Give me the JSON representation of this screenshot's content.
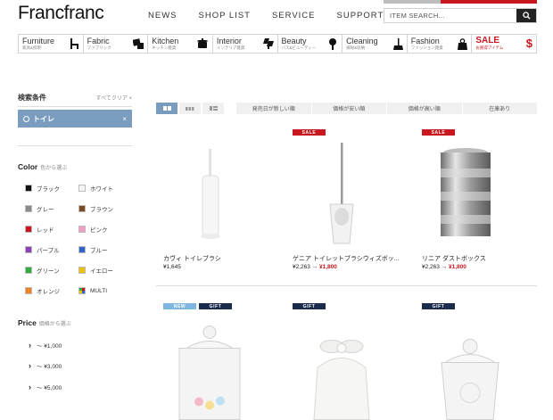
{
  "header": {
    "logo": "Francfranc",
    "nav": [
      "NEWS",
      "SHOP LIST",
      "SERVICE",
      "SUPPORT"
    ],
    "search_placeholder": "ITEM SEARCH..."
  },
  "categories": [
    {
      "name": "Furniture",
      "sub": "家具&照明",
      "icon": "chair-icon"
    },
    {
      "name": "Fabric",
      "sub": "ファブリック",
      "icon": "fabric-icon"
    },
    {
      "name": "Kitchen",
      "sub": "キッチン雑貨",
      "icon": "pot-icon"
    },
    {
      "name": "Interior",
      "sub": "インテリア雑貨",
      "icon": "lamp-icon"
    },
    {
      "name": "Beauty",
      "sub": "バス&ビューティー",
      "icon": "brush-icon"
    },
    {
      "name": "Cleaning",
      "sub": "掃除&収納",
      "icon": "broom-icon"
    },
    {
      "name": "Fashion",
      "sub": "ファッション雑貨",
      "icon": "bag-icon"
    },
    {
      "name": "SALE",
      "sub": "お買得アイテム",
      "icon": "dollar-icon"
    }
  ],
  "sidebar": {
    "conditions_title": "検索条件",
    "clear_label": "すべてクリア ×",
    "active_filter": "トイレ",
    "active_filter_remove": "×",
    "color_title": "Color",
    "color_sub": "色から選ぶ",
    "colors": [
      {
        "label": "ブラック",
        "hex": "#111111"
      },
      {
        "label": "ホワイト",
        "hex": "#f4f4f4"
      },
      {
        "label": "グレー",
        "hex": "#8a8a8a"
      },
      {
        "label": "ブラウン",
        "hex": "#7a4a1e"
      },
      {
        "label": "レッド",
        "hex": "#d0141c"
      },
      {
        "label": "ピンク",
        "hex": "#f39ec4"
      },
      {
        "label": "パープル",
        "hex": "#8a3fb5"
      },
      {
        "label": "ブルー",
        "hex": "#2e63c9"
      },
      {
        "label": "グリーン",
        "hex": "#2fae3c"
      },
      {
        "label": "イエロー",
        "hex": "#f2c200"
      },
      {
        "label": "オレンジ",
        "hex": "#f0821e"
      },
      {
        "label": "MULTI",
        "hex": "multi"
      }
    ],
    "price_title": "Price",
    "price_sub": "価格から選ぶ",
    "prices": [
      "〜 ¥1,000",
      "〜 ¥3,000",
      "〜 ¥5,000"
    ]
  },
  "sort_bar": {
    "view_icons": [
      "grid-large-icon",
      "grid-medium-icon",
      "list-icon"
    ],
    "options": [
      "発売日が新しい順",
      "価格が安い順",
      "価格が高い順",
      "在庫あり"
    ]
  },
  "products": [
    {
      "name": "カヴィ トイレブラシ",
      "price": "¥1,645",
      "sale_price": "",
      "badges": []
    },
    {
      "name": "ゲニア トイレットブラシウィズボッ...",
      "price": "¥2,263 →",
      "sale_price": "¥1,800",
      "badges": [
        "SALE"
      ]
    },
    {
      "name": "リニア ダストボックス",
      "price": "¥2,263 →",
      "sale_price": "¥1,800",
      "badges": [
        "SALE"
      ]
    },
    {
      "name": "",
      "price": "",
      "sale_price": "",
      "badges": [
        "NEW",
        "GIFT"
      ]
    },
    {
      "name": "",
      "price": "",
      "sale_price": "",
      "badges": [
        "GIFT"
      ]
    },
    {
      "name": "",
      "price": "",
      "sale_price": "",
      "badges": [
        "GIFT"
      ]
    }
  ]
}
